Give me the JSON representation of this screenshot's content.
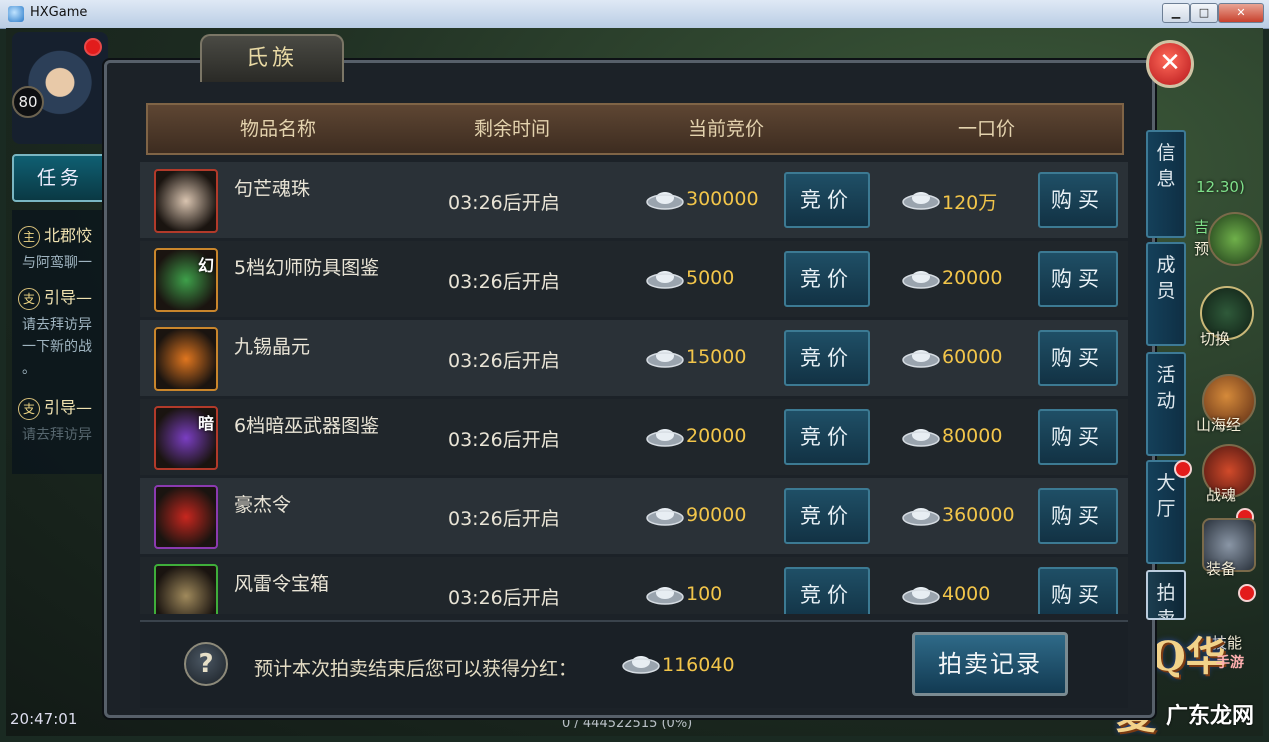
{
  "window": {
    "title": "HXGame",
    "minimize": "▁",
    "maximize": "□",
    "close": "✕"
  },
  "hud": {
    "level": "80",
    "task_button": "任务",
    "quests": [
      {
        "badge": "主",
        "title": "北郡恔",
        "desc": "与阿鸾聊一"
      },
      {
        "badge": "支",
        "title": "引导—",
        "desc": "请去拜访异",
        "desc2": "一下新的战",
        "desc3": "。"
      },
      {
        "badge": "支",
        "title": "引导—",
        "desc": "请去拜访异"
      }
    ],
    "clock": "20:47:01",
    "right": {
      "coords": "12.30)",
      "switch_label": "切换",
      "shanhaijing_label": "山海经",
      "zhanhun_label": "战魂",
      "equip_label": "装备",
      "skill_label": "技能",
      "yu_label": "预",
      "hui_label": "吉"
    },
    "brand": "QQ华夏",
    "brand_sub": "手游",
    "watermark": "广东龙网",
    "status_bar": "0 / 444522515 (0%)"
  },
  "panel": {
    "title": "氏族",
    "close_label": "✕",
    "columns": {
      "name": "物品名称",
      "time": "剩余时间",
      "bid": "当前竞价",
      "buyout": "一口价"
    },
    "items": [
      {
        "name": "句芒魂珠",
        "time": "03:26后开启",
        "bid": "300000",
        "buyout": "120万",
        "bid_btn": "竞价",
        "buy_btn": "购买",
        "frame": "#b23a2a",
        "icon_color": "#d9c4b0"
      },
      {
        "name": "5档幻师防具图鉴",
        "time": "03:26后开启",
        "bid": "5000",
        "buyout": "20000",
        "bid_btn": "竞价",
        "buy_btn": "购买",
        "frame": "#c9862c",
        "icon_color": "#3ea04a",
        "glyph": "幻"
      },
      {
        "name": "九锡晶元",
        "time": "03:26后开启",
        "bid": "15000",
        "buyout": "60000",
        "bid_btn": "竞价",
        "buy_btn": "购买",
        "frame": "#c9862c",
        "icon_color": "#e0761f"
      },
      {
        "name": "6档暗巫武器图鉴",
        "time": "03:26后开启",
        "bid": "20000",
        "buyout": "80000",
        "bid_btn": "竞价",
        "buy_btn": "购买",
        "frame": "#b23a2a",
        "icon_color": "#7a3ec2",
        "glyph": "暗"
      },
      {
        "name": "豪杰令",
        "time": "03:26后开启",
        "bid": "90000",
        "buyout": "360000",
        "bid_btn": "竞价",
        "buy_btn": "购买",
        "frame": "#8b3ab0",
        "icon_color": "#c8271f"
      },
      {
        "name": "风雷令宝箱",
        "time": "03:26后开启",
        "bid": "100",
        "buyout": "4000",
        "bid_btn": "竞价",
        "buy_btn": "购买",
        "frame": "#3fae3a",
        "icon_color": "#a08a5c"
      }
    ],
    "side_tabs": [
      {
        "label": "信息"
      },
      {
        "label": "成员"
      },
      {
        "label": "活动"
      },
      {
        "label": "大厅"
      },
      {
        "label": "拍卖"
      }
    ],
    "footer": {
      "help": "?",
      "text": "预计本次拍卖结束后您可以获得分红：",
      "dividend": "116040",
      "record_button": "拍卖记录"
    }
  }
}
